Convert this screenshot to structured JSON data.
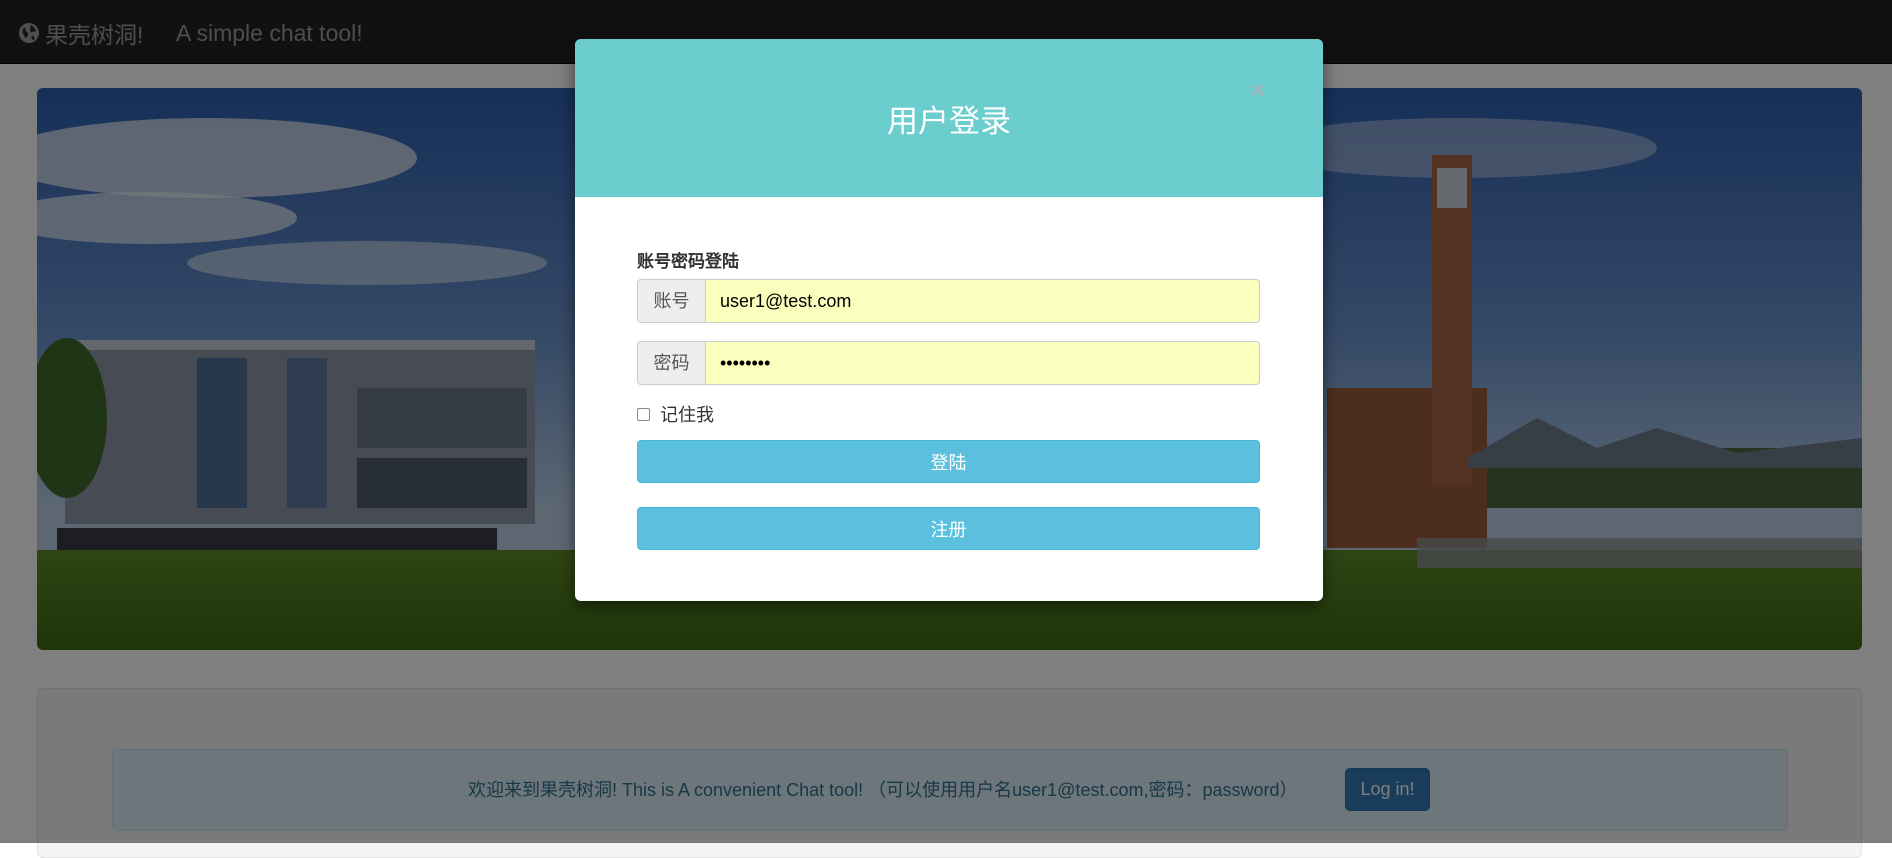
{
  "navbar": {
    "brand": "果壳树洞!",
    "brand_icon": "globe-icon",
    "tagline": "A simple chat tool!"
  },
  "alert": {
    "message": "欢迎来到果壳树洞!    This is A convenient Chat tool!  （可以使用用户名user1@test.com,密码：password）",
    "login_label": "Log in!"
  },
  "modal": {
    "title": "用户登录",
    "close_label": "×",
    "section_label": "账号密码登陆",
    "account_label": "账号",
    "account_value": "user1@test.com",
    "password_label": "密码",
    "password_value": "password",
    "remember_label": "记住我",
    "remember_checked": false,
    "login_button": "登陆",
    "register_button": "注册"
  },
  "colors": {
    "navbar": "#222222",
    "modal_header": "#6bcdcd",
    "button_info": "#5bc0de",
    "button_primary": "#337ab7",
    "autofill": "#faffbd"
  }
}
